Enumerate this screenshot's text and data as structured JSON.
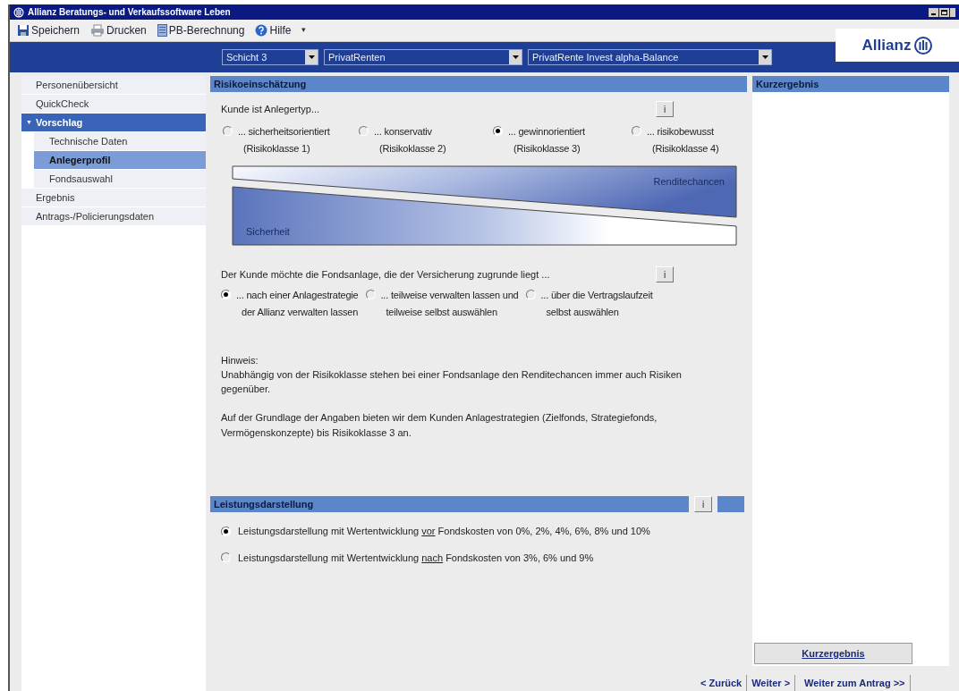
{
  "window": {
    "title": "Allianz Beratungs- und Verkaufssoftware Leben"
  },
  "toolbar": [
    {
      "label": "Speichern",
      "kind": "save"
    },
    {
      "label": "Drucken",
      "kind": "print"
    },
    {
      "label": "PB-Berechnung",
      "kind": "calc"
    },
    {
      "label": "Hilfe",
      "kind": "help"
    }
  ],
  "toolbar_menu": "▾",
  "logo": {
    "text": "Allianz"
  },
  "selectors": [
    {
      "value": "Schicht 3"
    },
    {
      "value": "PrivatRenten"
    },
    {
      "value": "PrivatRente Invest alpha-Balance"
    }
  ],
  "sidebar": {
    "items": [
      {
        "label": "Personenübersicht",
        "selected": false
      },
      {
        "label": "QuickCheck",
        "selected": false
      },
      {
        "label": "Vorschlag",
        "expanded": true,
        "expand_icon": "▼",
        "children": [
          {
            "label": "Technische Daten",
            "selected": false
          },
          {
            "label": "Anlegerprofil",
            "selected": true
          },
          {
            "label": "Fondsauswahl",
            "selected": false
          }
        ]
      },
      {
        "label": "Ergebnis",
        "selected": false
      },
      {
        "label": "Antrags-/Policierungsdaten",
        "selected": false
      }
    ]
  },
  "risk": {
    "title": "Risikoeinschätzung",
    "question": "Kunde ist Anlegertyp...",
    "info": "i",
    "options": [
      {
        "line1": "... sicherheitsorientiert",
        "line2": "(Risikoklasse 1)",
        "selected": false
      },
      {
        "line1": "... konservativ",
        "line2": "(Risikoklasse 2)",
        "selected": false
      },
      {
        "line1": "... gewinnorientiert",
        "line2": "(Risikoklasse 3)",
        "selected": true
      },
      {
        "line1": "... risikobewusst",
        "line2": "(Risikoklasse 4)",
        "selected": false
      }
    ],
    "diagram": {
      "top_label": "Renditechancen",
      "bottom_label": "Sicherheit"
    },
    "question2": "Der Kunde möchte die Fondsanlage, die der Versicherung zugrunde liegt ...",
    "info2": "i",
    "options2": [
      {
        "line1": "... nach einer Anlagestrategie",
        "line2": "der Allianz verwalten lassen",
        "selected": true
      },
      {
        "line1": "... teilweise verwalten lassen und",
        "line2": "teilweise selbst auswählen",
        "selected": false
      },
      {
        "line1": "... über die Vertragslaufzeit",
        "line2": "selbst auswählen",
        "selected": false
      }
    ],
    "note_title": "Hinweis:",
    "note": "Unabhängig von der Risikoklasse stehen bei einer Fondsanlage den Renditechancen immer auch Risiken gegenüber.",
    "offer": "Auf der Grundlage der Angaben bieten wir dem Kunden Anlagestrategien (Zielfonds, Strategiefonds, Vermögenskonzepte) bis Risikoklasse 3 an."
  },
  "performance": {
    "title": "Leistungsdarstellung",
    "info": "i",
    "options": [
      {
        "before": "Leistungsdarstellung mit Wertentwicklung ",
        "underlined": "vor",
        "after": " Fondskosten von 0%, 2%, 4%, 6%, 8% und 10%",
        "selected": true
      },
      {
        "before": "Leistungsdarstellung mit Wertentwicklung ",
        "underlined": "nach",
        "after": " Fondskosten von 3%, 6% und 9%",
        "selected": false
      }
    ]
  },
  "summary": {
    "title": "Kurzergebnis",
    "button": "Kurzergebnis"
  },
  "navigation": [
    "< Zurück",
    "Weiter >",
    "Weiter zum Antrag >>"
  ]
}
